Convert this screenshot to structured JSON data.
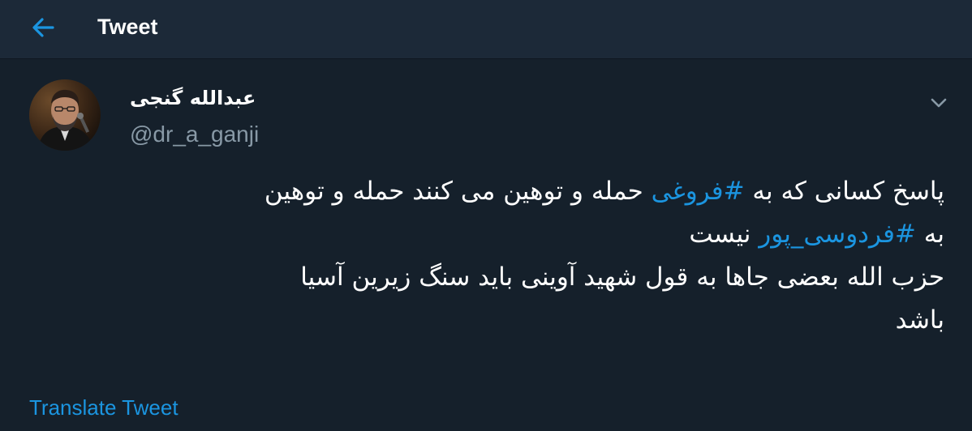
{
  "header": {
    "title": "Tweet",
    "back_icon": "arrow-left-icon",
    "accent_color": "#1b95e0"
  },
  "tweet": {
    "author": {
      "name": "عبدالله گنجی",
      "handle": "@dr_a_ganji"
    },
    "menu_icon": "chevron-down-icon",
    "body": {
      "line1": {
        "before": "پاسخ کسانی که به ",
        "hashtag": "#فروغی",
        "after": " حمله و توهین می کنند حمله و توهین"
      },
      "line2": {
        "before": "به ",
        "hashtag": "#فردوسی_پور",
        "after": " نیست"
      },
      "line3": "حزب الله بعضی جاها به قول شهید آوینی باید سنگ زیرین آسیا",
      "line4": "باشد"
    },
    "translate_label": "Translate Tweet"
  },
  "colors": {
    "background": "#15202b",
    "header_background": "#1c2938",
    "secondary_text": "#8899a6",
    "primary_text": "#ffffff"
  }
}
